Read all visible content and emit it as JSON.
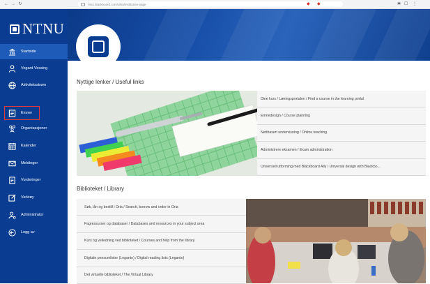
{
  "browser": {
    "url": "ntnu.blackboard.com/ultra/institution-page"
  },
  "sidebar": {
    "logo_text": "NTNU",
    "items": [
      {
        "label": "Startside",
        "icon": "institution-icon"
      },
      {
        "label": "Vegard Vessing",
        "icon": "person-icon"
      },
      {
        "label": "Aktivitetsstrøm",
        "icon": "globe-icon"
      },
      {
        "label": "Emner",
        "icon": "courses-icon"
      },
      {
        "label": "Organisasjoner",
        "icon": "organizations-icon"
      },
      {
        "label": "Kalender",
        "icon": "calendar-icon"
      },
      {
        "label": "Meldinger",
        "icon": "mail-icon"
      },
      {
        "label": "Vurderinger",
        "icon": "grades-icon"
      },
      {
        "label": "Verktøy",
        "icon": "tools-icon"
      },
      {
        "label": "Administrator",
        "icon": "admin-icon"
      },
      {
        "label": "Logg av",
        "icon": "logout-icon"
      }
    ],
    "active_item": "Startside",
    "highlighted_item": "Emner",
    "highlight_color": "#e03b3b",
    "background_color": "#0a3d91"
  },
  "main": {
    "useful_links": {
      "title": "Nyttige lenker / Useful links",
      "links": [
        "Dine kurs / Læringsportalen / Find a course in the learning portal",
        "Emnedesign / Course planning",
        "Nettbasert undervisning / Online teaching",
        "Administrere eksamen / Exam administration",
        "Universell utforming med Blackboard Ally / Universal design with Blackbo..."
      ]
    },
    "library": {
      "title": "Biblioteket / Library",
      "links": [
        "Søk, lån og bestill i Oria / Search, borrow and order in Oria",
        "Fagressurser og databaser / Databases and resources in your subject area",
        "Kurs og veiledning ved biblioteket / Courses and help from the library",
        "Digitale pensumlister (Leganto) / Digital reading lists (Leganto)",
        "Det virtuelle biblioteket / The Virtual Library"
      ]
    }
  }
}
